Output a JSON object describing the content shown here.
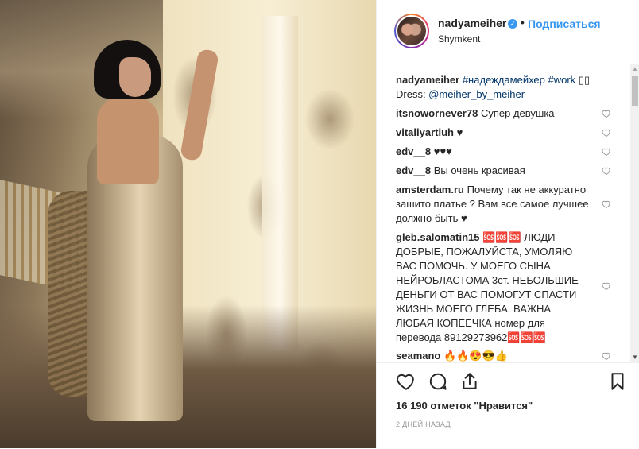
{
  "post": {
    "username": "nadyameiher",
    "follow_label": "Подписаться",
    "location": "Shymkent",
    "caption": {
      "user": "nadyameiher",
      "text1": "#надеждамейхер #work",
      "text1_tail": " \u0000\u0000",
      "text2": "Dress: ",
      "text2_tag": "@meiher_by_meiher"
    },
    "comments": [
      {
        "user": "itsnowornever78",
        "text": "Супер девушка"
      },
      {
        "user": "vitaliyartiuh",
        "text": "♥"
      },
      {
        "user": "edv__8",
        "text": "♥♥♥"
      },
      {
        "user": "edv__8",
        "text": "Вы очень красивая"
      },
      {
        "user": "amsterdam.ru",
        "text": "Почему так не аккуратно зашито платье ? Вам все самое лучшее должно быть ♥"
      },
      {
        "user": "gleb.salomatin15",
        "text": "🆘🆘🆘 ЛЮДИ ДОБРЫЕ, ПОЖАЛУЙСТА, УМОЛЯЮ ВАС ПОМОЧЬ. У МОЕГО СЫНА НЕЙРОБЛАСТОМА 3ст. НЕБОЛЬШИЕ ДЕНЬГИ ОТ ВАС ПОМОГУТ СПАСТИ ЖИЗНЬ МОЕГО ГЛЕБА. ВАЖНА ЛЮБАЯ КОПЕЕЧКА номер для перевода 89129273962🆘🆘🆘"
      },
      {
        "user": "seamano",
        "text": "🔥🔥😍😎👍"
      }
    ],
    "likes": "16 190 отметок \"Нравится\"",
    "time": "2 ДНЕЙ НАЗАД"
  },
  "icons": [
    "verified-icon",
    "like-icon",
    "comment-icon",
    "share-icon",
    "bookmark-icon",
    "comment-heart-icon"
  ],
  "colors": {
    "link": "#3897f0",
    "hashtag": "#003569",
    "muted": "#999999"
  }
}
